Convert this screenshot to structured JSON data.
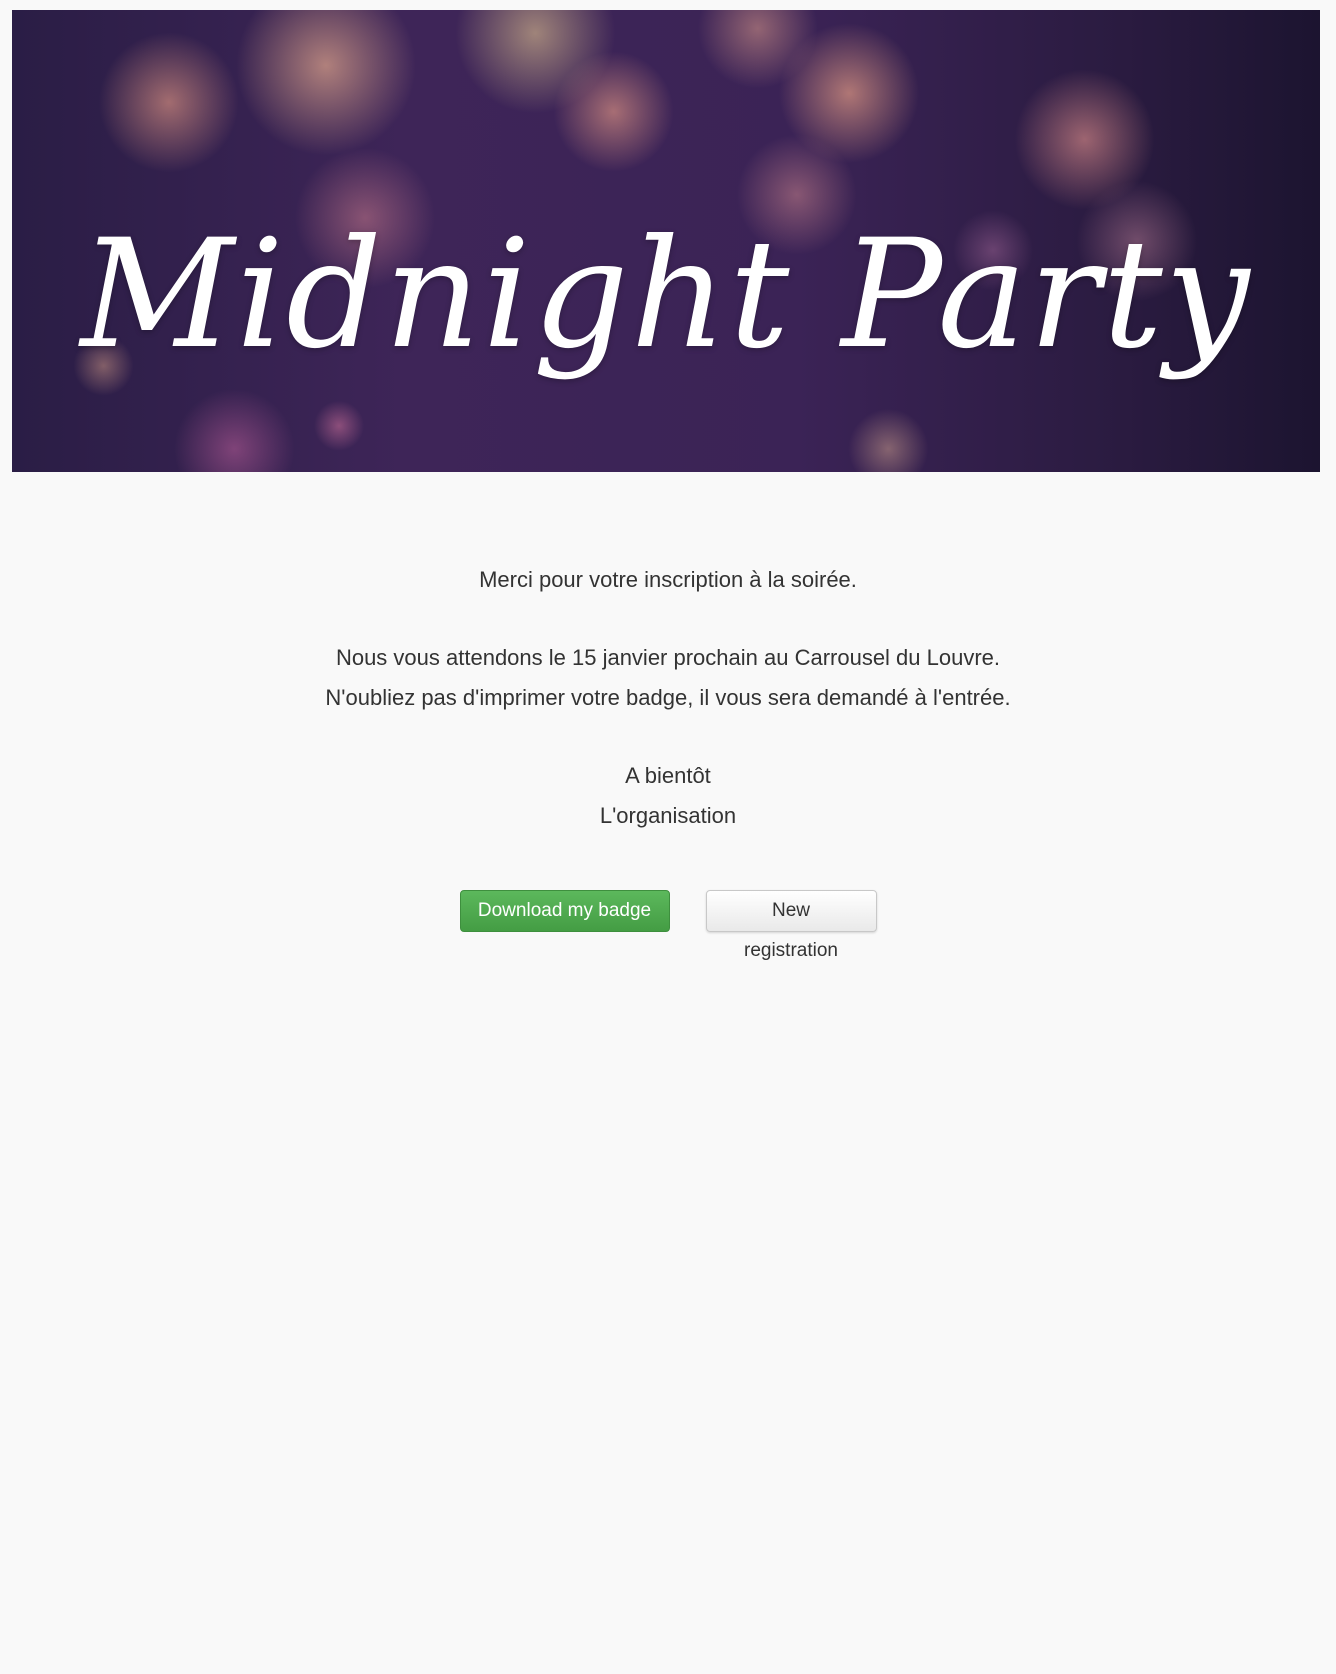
{
  "banner": {
    "title": "Midnight Party"
  },
  "message": {
    "thanks": "Merci pour votre inscription à la soirée.",
    "line_date": "Nous vous attendons le 15 janvier prochain au Carrousel du Louvre.",
    "line_badge": "N'oubliez pas d'imprimer votre badge, il vous sera demandé à l'entrée.",
    "closing": "A bientôt",
    "signature": "L'organisation"
  },
  "actions": {
    "download_label": "Download my badge",
    "new_registration_label": "New registration"
  },
  "colors": {
    "success": "#5cb85c",
    "page_background": "#f9f9f9",
    "text": "#333333"
  }
}
